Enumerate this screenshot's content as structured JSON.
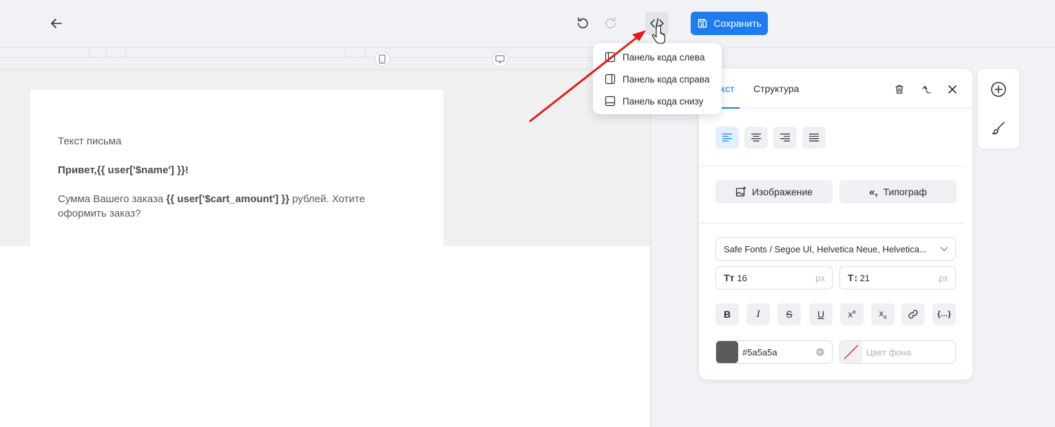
{
  "toolbar": {
    "back_icon": "arrow-left-icon",
    "undo_icon": "undo-icon",
    "redo_icon": "redo-icon",
    "code_icon": "code-icon",
    "save_label": "Сохранить",
    "save_icon": "floppy-disk-icon"
  },
  "code_menu": {
    "items": [
      {
        "label": "Панель кода слева",
        "icon": "panel-left-icon"
      },
      {
        "label": "Панель кода справа",
        "icon": "panel-right-icon"
      },
      {
        "label": "Панель кода снизу",
        "icon": "panel-bottom-icon"
      }
    ]
  },
  "letter": {
    "heading": "Текст письма",
    "greeting": "Привет,{{ user['$name'] }}!",
    "body_before": "Сумма Вашего заказа ",
    "body_var": "{{ user['$cart_amount'] }}",
    "body_after": " рублей. Хотите оформить заказ?"
  },
  "panel": {
    "tab_text": "екст",
    "tab_structure": "Структура",
    "image_button": "Изображение",
    "typograph_button": "Типограф",
    "font_family": "Safe Fonts / Segoe UI, Helvetica Neue, Helvetica...",
    "font_size": "16",
    "line_height": "21",
    "unit": "px",
    "text_color": "#5a5a5a",
    "bg_color_placeholder": "Цвет фона"
  },
  "colors": {
    "accent": "#1e7bf0",
    "annotation_arrow": "#e01b1b",
    "text_swatch": "#5a5a5a"
  }
}
